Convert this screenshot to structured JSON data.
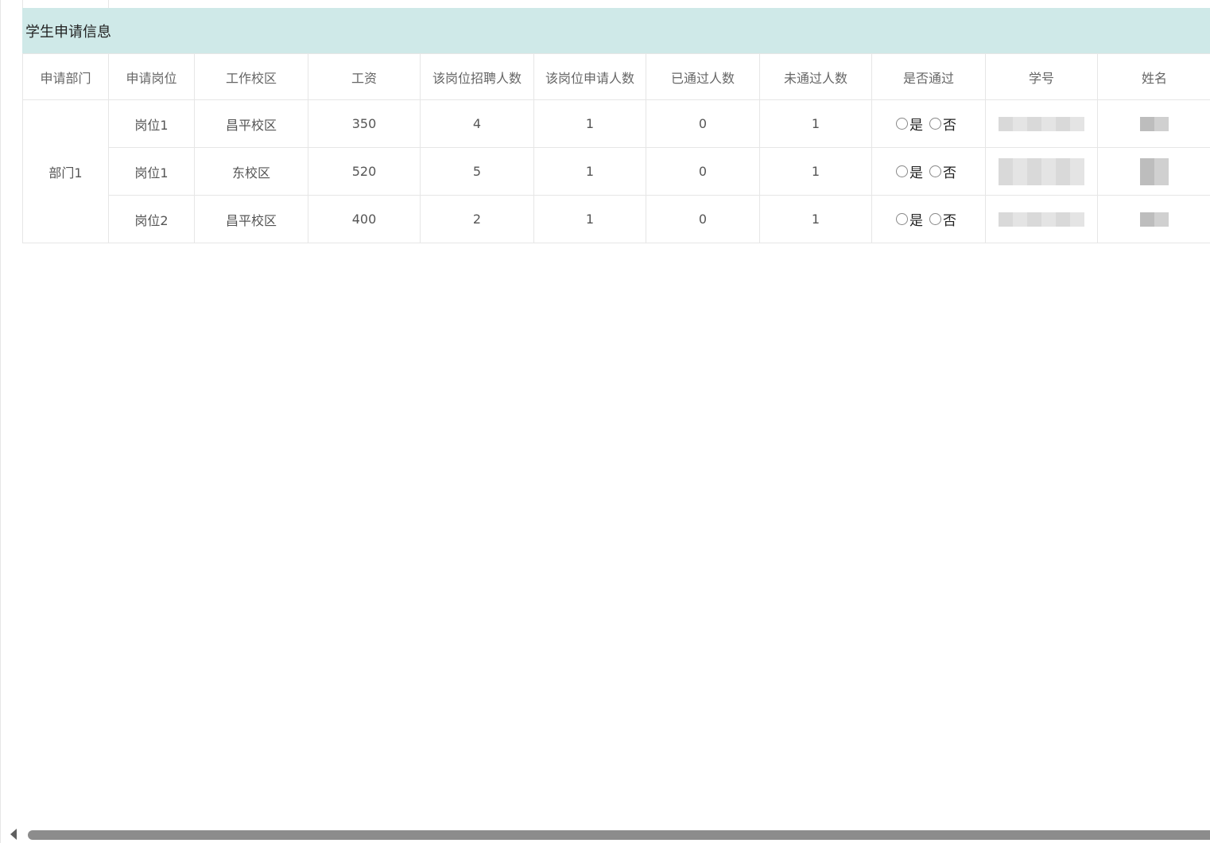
{
  "panel": {
    "title": "学生申请信息"
  },
  "table": {
    "headers": [
      "申请部门",
      "申请岗位",
      "工作校区",
      "工资",
      "该岗位招聘人数",
      "该岗位申请人数",
      "已通过人数",
      "未通过人数",
      "是否通过",
      "学号",
      "姓名"
    ],
    "department": "部门1",
    "rows": [
      {
        "position": "岗位1",
        "campus": "昌平校区",
        "salary": "350",
        "recruit_count": "4",
        "apply_count": "1",
        "passed": "0",
        "not_passed": "1"
      },
      {
        "position": "岗位1",
        "campus": "东校区",
        "salary": "520",
        "recruit_count": "5",
        "apply_count": "1",
        "passed": "0",
        "not_passed": "1"
      },
      {
        "position": "岗位2",
        "campus": "昌平校区",
        "salary": "400",
        "recruit_count": "2",
        "apply_count": "1",
        "passed": "0",
        "not_passed": "1"
      }
    ],
    "radio_labels": {
      "yes": "是",
      "no": "否"
    }
  }
}
